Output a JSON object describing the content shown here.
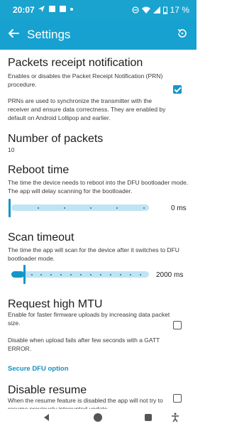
{
  "status_bar": {
    "time": "20:07",
    "battery": "17 %"
  },
  "app_bar": {
    "title": "Settings"
  },
  "prefs": {
    "prn": {
      "title": "Packets receipt notification",
      "summary": "Enables or disables the Packet Receipt Notification (PRN) procedure.",
      "detail": "PRNs are used to synchronize the transmitter with the receiver and ensure data correctness. They are enabled by default on Android Lollipop and earlier.",
      "checked": true
    },
    "packets": {
      "title": "Number of packets",
      "value": "10"
    },
    "reboot": {
      "title": "Reboot time",
      "summary": "The time the device needs to reboot into the DFU bootloader mode. The app will delay scanning for the bootloader.",
      "value_label": "0 ms",
      "level": 0
    },
    "scan": {
      "title": "Scan timeout",
      "summary": "The time the app will scan for the device after it switches to DFU bootloader mode.",
      "value_label": "2000 ms",
      "level": 0.1
    },
    "mtu": {
      "title": "Request high MTU",
      "summary": "Enable for faster firmware uploads by increasing data packet size.",
      "detail": "Disable when upload fails after few seconds with a GATT ERROR.",
      "checked": false
    },
    "secure_dfu_link": "Secure DFU option",
    "resume": {
      "title": "Disable resume",
      "summary": "When the resume feature is disabled the app will not try to resume previously interrupted update.",
      "checked": false
    }
  },
  "icons": {
    "back": "arrow-left-icon",
    "restore": "restore-icon",
    "nav_back": "triangle-back-icon",
    "nav_home": "circle-home-icon",
    "nav_recent": "square-recent-icon",
    "nav_access": "accessibility-icon"
  }
}
